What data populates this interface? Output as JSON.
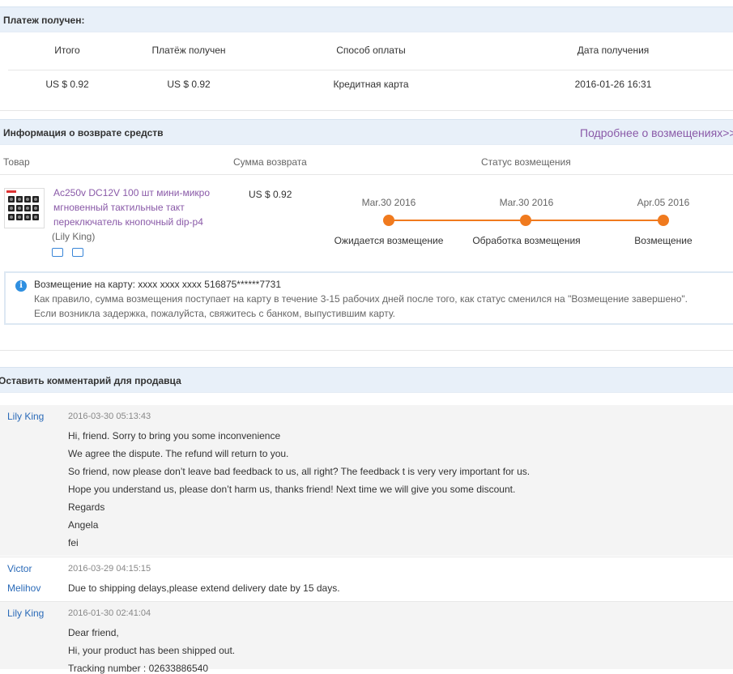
{
  "payment": {
    "section_title": "Платеж получен:",
    "headers": [
      "Итого",
      "Платёж получен",
      "Способ оплаты",
      "Дата получения"
    ],
    "values": [
      "US $ 0.92",
      "US $ 0.92",
      "Кредитная карта",
      "2016-01-26 16:31"
    ]
  },
  "refund": {
    "section_title": "Информация о возврате средств",
    "more_link": "Подробнее о возмещениях>>",
    "col_product": "Товар",
    "col_amount": "Сумма возврата",
    "col_status": "Статус возмещения",
    "product_title_line1": "Ac250v DC12V 100 шт мини-микро",
    "product_title_line2": "мгновенный тактильные такт",
    "product_title_line3": "переключатель кнопочный dip-p4",
    "seller": "(Lily King)",
    "amount": "US $ 0.92",
    "timeline": [
      {
        "date": "Mar.30 2016",
        "label": "Ожидается возмещение"
      },
      {
        "date": "Mar.30 2016",
        "label": "Обработка возмещения"
      },
      {
        "date": "Apr.05 2016",
        "label": "Возмещение"
      }
    ],
    "info_label": "Возмещение на карту:",
    "info_card": "xxxx xxxx xxxx 516875******7731",
    "info_line2": "Как правило, сумма возмещения поступает на карту в течение 3-15 рабочих дней после того, как статус сменился на \"Возмещение завершено\".",
    "info_line3": "Если возникла задержка, пожалуйста, свяжитесь с банком, выпустившим карту."
  },
  "comments": {
    "section_title": "Оставить комментарий для продавца",
    "c1_author": "Lily King",
    "c1_date": "2016-03-30 05:13:43",
    "c1_lines": [
      "Hi, friend. Sorry to bring you some inconvenience",
      "We agree the dispute. The refund will return to you.",
      "So friend, now please don’t leave bad feedback to us, all right? The feedback t is very very important for us.",
      "Hope you understand us, please don’t harm us, thanks friend! Next time we will give you some discount.",
      "Regards",
      "Angela",
      "fei"
    ],
    "c2_author_line1": "Victor",
    "c2_author_line2": "Melihov",
    "c2_date": "2016-03-29 04:15:15",
    "c2_text": "Due to shipping delays,please extend delivery date by 15 days.",
    "c3_author": "Lily King",
    "c3_date": "2016-01-30 02:41:04",
    "c3_lines": [
      "Dear friend,",
      "Hi, your product has been shipped out.",
      "Tracking number : 02633886540"
    ]
  },
  "colors": {
    "header_bg": "#e8f0f9",
    "accent_orange": "#f07a1e",
    "link_purple": "#8a5aa8",
    "author_blue": "#2a6ab8"
  }
}
